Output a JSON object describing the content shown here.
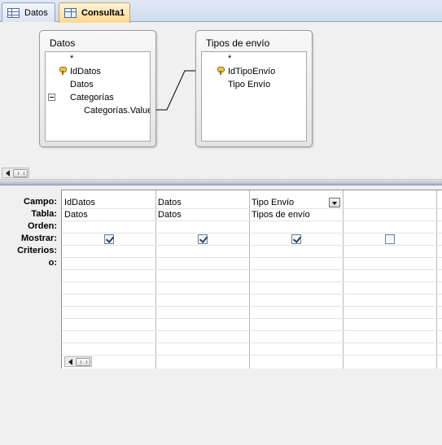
{
  "tabs": [
    {
      "label": "Datos",
      "icon": "table-icon",
      "active": false
    },
    {
      "label": "Consulta1",
      "icon": "query-icon",
      "active": true
    }
  ],
  "design": {
    "tables": [
      {
        "title": "Datos",
        "fields": [
          {
            "label": "*",
            "key": false
          },
          {
            "label": "IdDatos",
            "key": true
          },
          {
            "label": "Datos",
            "key": false
          },
          {
            "label": "Categorías",
            "key": false,
            "expander": "−"
          },
          {
            "label": "Categorías.Value",
            "key": false,
            "child": true
          }
        ]
      },
      {
        "title": "Tipos de envío",
        "fields": [
          {
            "label": "*",
            "key": false
          },
          {
            "label": "IdTipoEnvío",
            "key": true
          },
          {
            "label": "Tipo Envío",
            "key": false
          }
        ]
      }
    ]
  },
  "grid": {
    "row_labels": [
      "Campo:",
      "Tabla:",
      "Orden:",
      "Mostrar:",
      "Criterios:",
      "o:"
    ],
    "columns": [
      {
        "campo": "IdDatos",
        "tabla": "Datos",
        "orden": "",
        "mostrar": true,
        "criterios": "",
        "o": ""
      },
      {
        "campo": "Datos",
        "tabla": "Datos",
        "orden": "",
        "mostrar": true,
        "criterios": "",
        "o": ""
      },
      {
        "campo": "Tipo Envío",
        "tabla": "Tipos de envío",
        "orden": "",
        "mostrar": true,
        "criterios": "",
        "o": ""
      },
      {
        "campo": "",
        "tabla": "",
        "orden": "",
        "mostrar": false,
        "criterios": "",
        "o": ""
      }
    ]
  },
  "colors": {
    "active_tab": "#ffd88c",
    "tab_bar": "#cfdcec"
  }
}
